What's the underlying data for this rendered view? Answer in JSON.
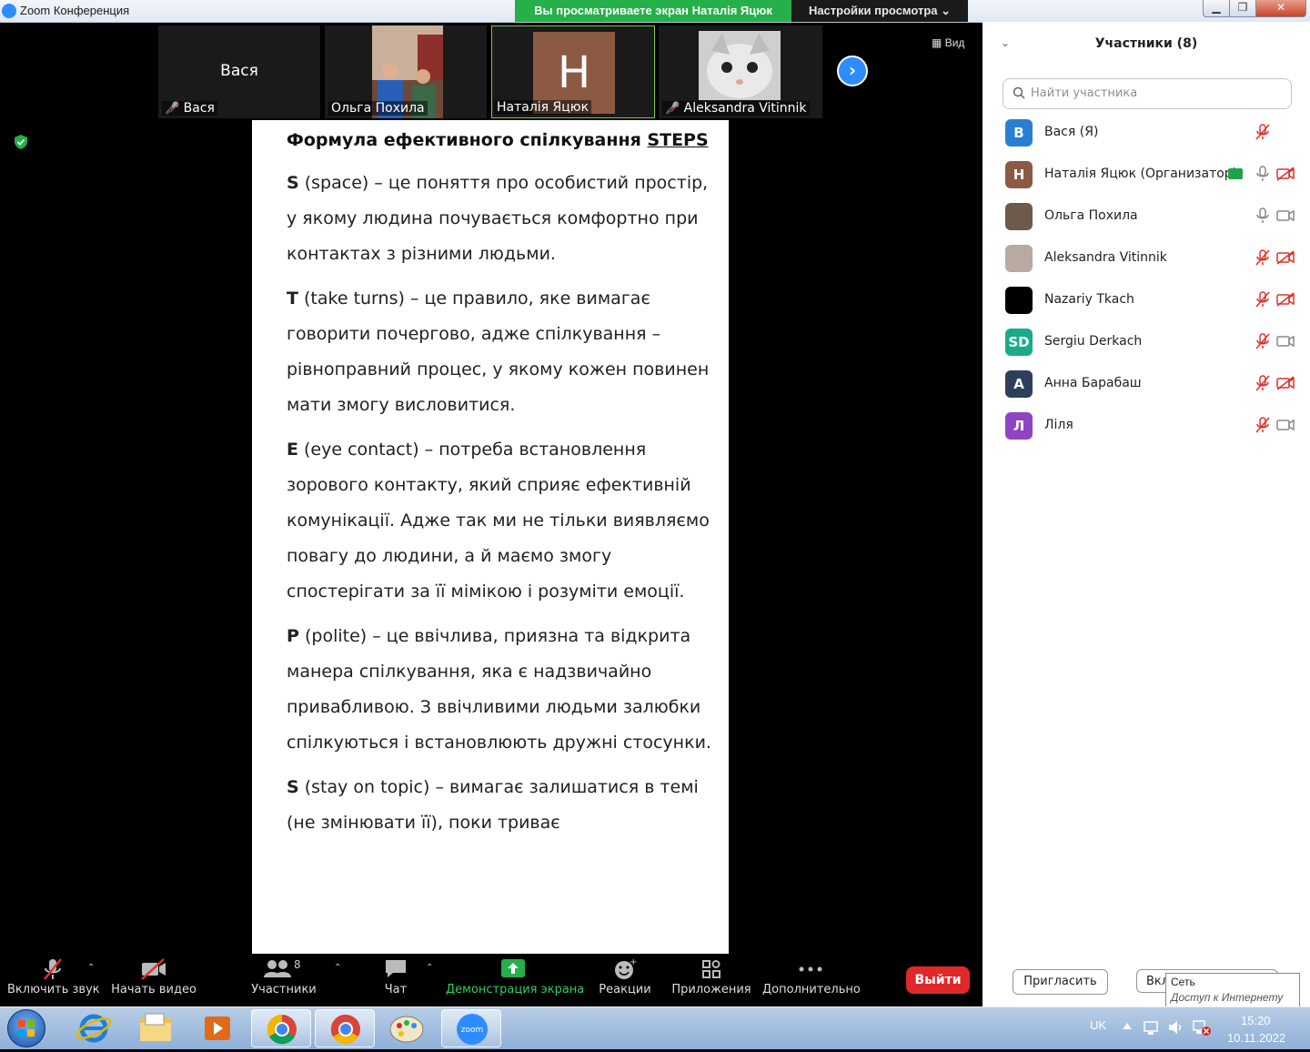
{
  "window": {
    "title": "Zoom Конференция",
    "share_banner": "Вы просматриваете экран Наталія Яцюк",
    "view_settings": "Настройки просмотра",
    "view_label": "Вид"
  },
  "video_tiles": [
    {
      "name": "Вася",
      "big_name": "Вася",
      "muted": true
    },
    {
      "name": "Ольга Похила",
      "muted": false
    },
    {
      "name": "Наталія Яцюк",
      "initial": "H",
      "muted": false
    },
    {
      "name": "Aleksandra Vitinnik",
      "muted": true
    }
  ],
  "document": {
    "heading_prefix": "Формула ефективного спілкування ",
    "heading_acronym": "STEPS",
    "paragraphs": [
      {
        "letter": "S",
        "term": " (space)",
        "text": " – це поняття про особистий простір, у якому людина почувається комфортно при контактах з різними людьми."
      },
      {
        "letter": "T",
        "term": " (take turns)",
        "text": " – це правило, яке вимагає говорити почергово, адже спілкування –рівноправний процес, у якому кожен повинен мати змогу висловитися."
      },
      {
        "letter": "E",
        "term": " (eye contact)",
        "text": " – потреба встановлення зорового контакту, який сприяє ефективній комунікації. Адже так ми не тільки виявляємо повагу до людини, а й маємо змогу спостерігати за її мімікою і розуміти емоції."
      },
      {
        "letter": "P",
        "term": " (polite)",
        "text": " – це ввічлива, приязна та відкрита манера спілкування, яка є надзвичайно привабливою. З ввічливими людьми залюбки спілкуються і встановлюють дружні стосунки."
      },
      {
        "letter": "S",
        "term": " (stay on topic)",
        "text": " – вимагає залишатися в темі (не змінювати її), поки триває"
      }
    ]
  },
  "toolbar": {
    "audio": "Включить звук",
    "video": "Начать видео",
    "participants": "Участники",
    "participants_count": "8",
    "chat": "Чат",
    "share": "Демонстрация экрана",
    "reactions": "Реакции",
    "apps": "Приложения",
    "more": "Дополнительно",
    "leave": "Выйти"
  },
  "panel": {
    "title": "Участники (8)",
    "search_placeholder": "Найти участника",
    "participants": [
      {
        "initials": "B",
        "name": "Вася (Я)",
        "color": "#2a7fd4",
        "mic": "muted",
        "cam": "none"
      },
      {
        "initials": "H",
        "name": "Наталія Яцюк (Организатор)",
        "color": "#8c5a44",
        "mic": "on",
        "cam": "off"
      },
      {
        "initials": "",
        "name": "Ольга Похила",
        "color": "#6d5a4a",
        "mic": "on",
        "cam": "on"
      },
      {
        "initials": "",
        "name": "Aleksandra Vitinnik",
        "color": "#b8a9a3",
        "mic": "muted",
        "cam": "off"
      },
      {
        "initials": "",
        "name": "Nazariy Tkach",
        "color": "#000000",
        "mic": "muted",
        "cam": "off"
      },
      {
        "initials": "SD",
        "name": "Sergiu Derkach",
        "color": "#1aaa8c",
        "mic": "muted",
        "cam": "on"
      },
      {
        "initials": "A",
        "name": "Анна Барабаш",
        "color": "#2e3f5c",
        "mic": "muted",
        "cam": "off"
      },
      {
        "initials": "Л",
        "name": "Ліля",
        "color": "#8e44c4",
        "mic": "muted",
        "cam": "on"
      }
    ],
    "invite": "Пригласить",
    "other_button": "Вкл",
    "tooltip_title": "Сеть",
    "tooltip_text": "Доступ к Интернету"
  },
  "taskbar": {
    "lang": "UK",
    "time": "15:20",
    "date": "10.11.2022",
    "zoom_label": "zoom"
  },
  "colors": {
    "accent": "#2d8cff",
    "share_green": "#25b04a",
    "leave_red": "#e02828",
    "muted_red": "#e0302b"
  }
}
